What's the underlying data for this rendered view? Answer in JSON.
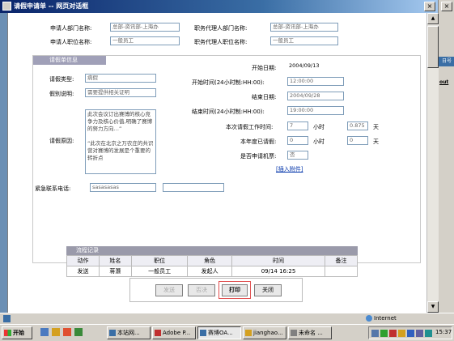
{
  "window": {
    "title": "请假申请单 -- 网页对话框"
  },
  "right_strip": {
    "header": "日号",
    "logout": "out"
  },
  "applicant": {
    "dept_label": "申请人部门名称:",
    "dept_value": "总部-资讯部-上海办",
    "job_label": "申请人职位名称:",
    "job_value": "一般员工",
    "proxy_dept_label": "职务代理人部门名称:",
    "proxy_dept_value": "总部-资讯部-上海办",
    "proxy_job_label": "职务代理人职位名称:",
    "proxy_job_value": "一般员工"
  },
  "leave": {
    "section_title": "请假单信息",
    "type_label": "请假类型:",
    "type_value": "病假",
    "desc_label": "假别说明:",
    "desc_placeholder": "需要提供相关证明",
    "reason_label": "请假原因:",
    "reason_text": "此次会议订出赛博的核心竞争力及核心价值,明确了赛博的努力方向…”\n\n“此次在北京之万农庄的共识营对赛博的发展是个重要的转折点",
    "start_date_label": "开始日期:",
    "start_date": "2004/09/13",
    "start_time_label": "开始时间(24小时制:HH:00):",
    "start_time": "12:00:00",
    "end_date_label": "结束日期:",
    "end_date": "2004/09/28",
    "end_time_label": "结束时间(24小时制:HH:00):",
    "end_time": "19:00:00",
    "workhours_label": "本次请假工作时间:",
    "workhours_hours": "7",
    "hours_unit": "小时",
    "workhours_days": "0.875",
    "days_unit": "天",
    "yearly_label": "本年度已请假:",
    "yearly_hours": "0",
    "yearly_days": "0",
    "ticket_label": "是否申请机票:",
    "ticket_value": "否",
    "attach_link": "[插入附件]",
    "emergency_label": "紧急联系电话:",
    "emergency_value": "sasasasas"
  },
  "flow": {
    "title": "流程记录",
    "headers": [
      "动作",
      "姓名",
      "职位",
      "角色",
      "时间",
      "备注"
    ],
    "row": [
      "发送",
      "蒋灏",
      "一般员工",
      "发起人",
      "09/14 16:25",
      ""
    ]
  },
  "buttons": {
    "send": "发送",
    "reject": "否决",
    "print": "打印",
    "close": "关闭"
  },
  "status": {
    "zone": "Internet"
  },
  "taskbar": {
    "start": "开始",
    "tasks": [
      "本站网...",
      "Adobe P...",
      "赛博OA...",
      "jianghao...",
      "未命名 ..."
    ],
    "clock": "15:37"
  }
}
